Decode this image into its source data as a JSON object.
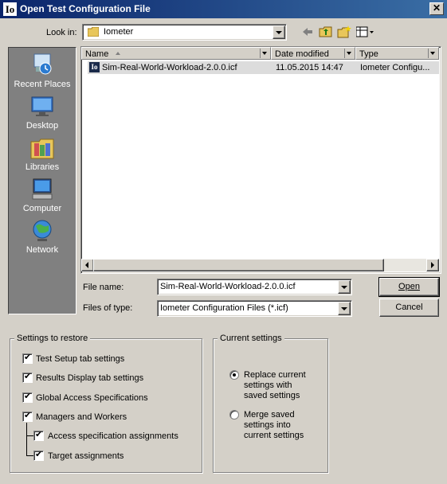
{
  "window": {
    "title": "Open Test Configuration File",
    "app_icon_text": "Io",
    "close_glyph": "✕"
  },
  "lookin": {
    "label": "Look in:",
    "value": "Iometer"
  },
  "toolbar": {
    "icons": [
      "back-arrow-icon",
      "up-folder-icon",
      "new-folder-icon",
      "view-menu-icon"
    ]
  },
  "places": [
    {
      "label": "Recent Places",
      "icon": "recent-places-icon"
    },
    {
      "label": "Desktop",
      "icon": "desktop-icon"
    },
    {
      "label": "Libraries",
      "icon": "libraries-icon"
    },
    {
      "label": "Computer",
      "icon": "computer-icon"
    },
    {
      "label": "Network",
      "icon": "network-icon"
    }
  ],
  "listview": {
    "columns": [
      "Name",
      "Date modified",
      "Type"
    ],
    "rows": [
      {
        "name": "Sim-Real-World-Workload-2.0.0.icf",
        "date": "11.05.2015 14:47",
        "type": "Iometer Configu..."
      }
    ]
  },
  "form": {
    "filename_label": "File name:",
    "filename_value": "Sim-Real-World-Workload-2.0.0.icf",
    "filetype_label": "Files of type:",
    "filetype_value": "Iometer Configuration Files (*.icf)",
    "open_label": "Open",
    "cancel_label": "Cancel"
  },
  "settings_restore": {
    "title": "Settings to restore",
    "items": [
      {
        "label": "Test Setup tab settings",
        "checked": true
      },
      {
        "label": "Results Display tab settings",
        "checked": true
      },
      {
        "label": "Global Access Specifications",
        "checked": true
      },
      {
        "label": "Managers and Workers",
        "checked": true
      },
      {
        "label": "Access specification assignments",
        "checked": true
      },
      {
        "label": "Target assignments",
        "checked": true
      }
    ]
  },
  "current_settings": {
    "title": "Current settings",
    "options": [
      {
        "line1": "Replace current",
        "line2": "settings with",
        "line3": "saved settings",
        "selected": true
      },
      {
        "line1": "Merge saved",
        "line2": "settings into",
        "line3": "current settings",
        "selected": false
      }
    ]
  }
}
